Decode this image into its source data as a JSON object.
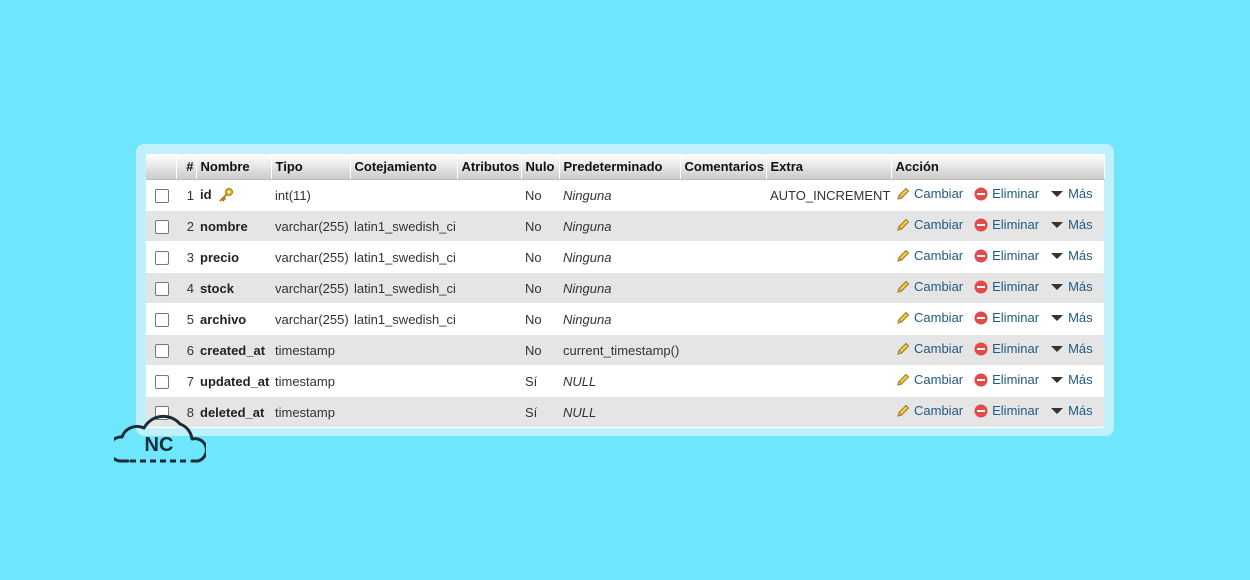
{
  "table": {
    "headers": {
      "num": "#",
      "nombre": "Nombre",
      "tipo": "Tipo",
      "cotejamiento": "Cotejamiento",
      "atributos": "Atributos",
      "nulo": "Nulo",
      "predeterminado": "Predeterminado",
      "comentarios": "Comentarios",
      "extra": "Extra",
      "accion": "Acción"
    },
    "actions": {
      "cambiar": "Cambiar",
      "eliminar": "Eliminar",
      "mas": "Más"
    },
    "rows": [
      {
        "num": "1",
        "name": "id",
        "type": "int(11)",
        "collation": "",
        "attributes": "",
        "null": "No",
        "default": "Ninguna",
        "default_italic": true,
        "comments": "",
        "extra": "AUTO_INCREMENT",
        "primary_key": true
      },
      {
        "num": "2",
        "name": "nombre",
        "type": "varchar(255)",
        "collation": "latin1_swedish_ci",
        "attributes": "",
        "null": "No",
        "default": "Ninguna",
        "default_italic": true,
        "comments": "",
        "extra": ""
      },
      {
        "num": "3",
        "name": "precio",
        "type": "varchar(255)",
        "collation": "latin1_swedish_ci",
        "attributes": "",
        "null": "No",
        "default": "Ninguna",
        "default_italic": true,
        "comments": "",
        "extra": ""
      },
      {
        "num": "4",
        "name": "stock",
        "type": "varchar(255)",
        "collation": "latin1_swedish_ci",
        "attributes": "",
        "null": "No",
        "default": "Ninguna",
        "default_italic": true,
        "comments": "",
        "extra": ""
      },
      {
        "num": "5",
        "name": "archivo",
        "type": "varchar(255)",
        "collation": "latin1_swedish_ci",
        "attributes": "",
        "null": "No",
        "default": "Ninguna",
        "default_italic": true,
        "comments": "",
        "extra": ""
      },
      {
        "num": "6",
        "name": "created_at",
        "type": "timestamp",
        "collation": "",
        "attributes": "",
        "null": "No",
        "default": "current_timestamp()",
        "default_italic": false,
        "comments": "",
        "extra": ""
      },
      {
        "num": "7",
        "name": "updated_at",
        "type": "timestamp",
        "collation": "",
        "attributes": "",
        "null": "Sí",
        "default": "NULL",
        "default_italic": true,
        "comments": "",
        "extra": ""
      },
      {
        "num": "8",
        "name": "deleted_at",
        "type": "timestamp",
        "collation": "",
        "attributes": "",
        "null": "Sí",
        "default": "NULL",
        "default_italic": true,
        "comments": "",
        "extra": ""
      }
    ]
  },
  "logo": {
    "text": "NC"
  },
  "icons": {
    "key": "key-icon",
    "edit": "pencil-icon",
    "delete": "delete-icon",
    "more": "triangle-down-icon"
  },
  "colors": {
    "background": "#6ee6fb",
    "panel": "#bff1fc",
    "link": "#235a81",
    "delete": "#e34b4b"
  }
}
